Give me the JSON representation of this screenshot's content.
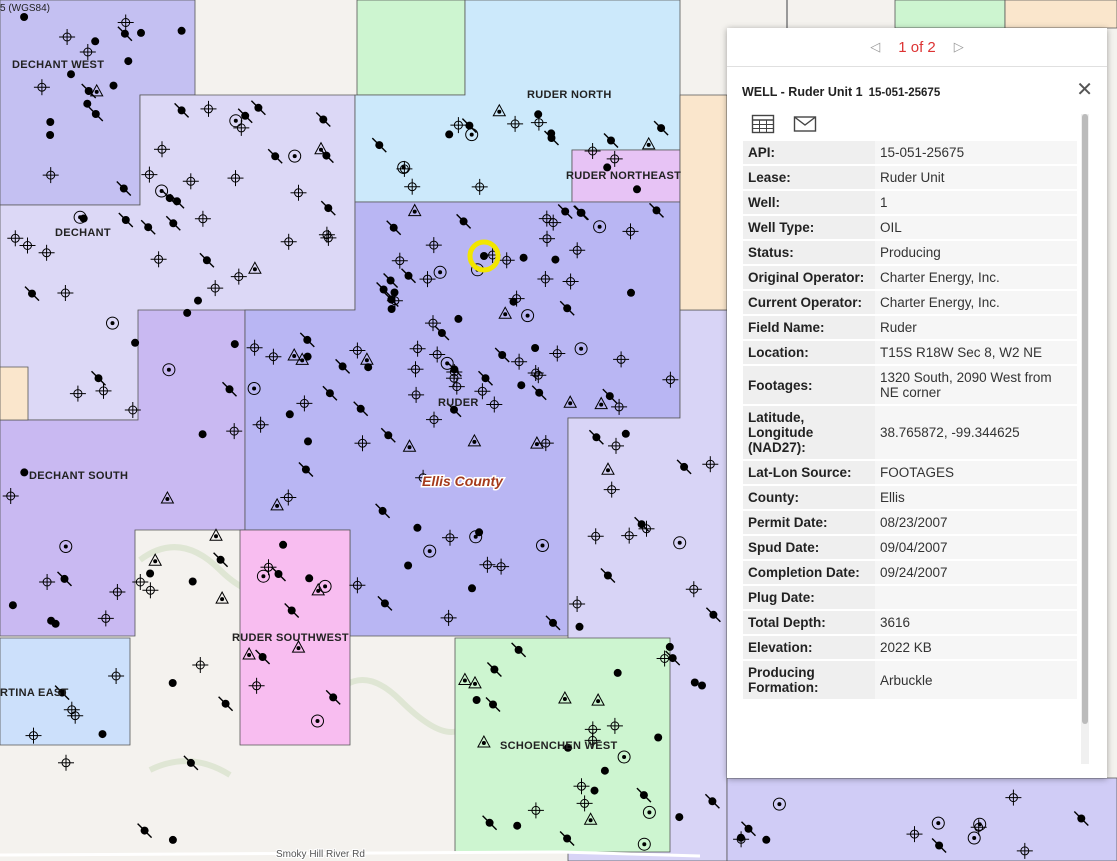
{
  "map": {
    "wgs_label": "5 (WGS84)",
    "county_label": "Ellis County",
    "road_label": "Smoky Hill River Rd",
    "fields": [
      {
        "name": "DECHANT WEST"
      },
      {
        "name": "RUDER NORTH"
      },
      {
        "name": "RUDER NORTHEAST"
      },
      {
        "name": "DECHANT"
      },
      {
        "name": "RUDER"
      },
      {
        "name": "DECHANT SOUTH"
      },
      {
        "name": "RUDER SOUTHWEST"
      },
      {
        "name": "RTINA EAST"
      },
      {
        "name": "SCHOENCHEN WEST"
      }
    ],
    "colors": {
      "purple": "#c4c0f2",
      "lavender": "#dcd8f6",
      "blue_violet": "#b9b6f3",
      "light_blue": "#cce9fb",
      "green": "#cdf5d0",
      "pink": "#f8bdf0",
      "magenta_light": "#e7c3f5",
      "peach": "#fae6cc",
      "highlight": "#f2e600"
    }
  },
  "popup": {
    "pager": {
      "prev_icon": "chevron-left-icon",
      "next_icon": "chevron-right-icon",
      "count": "1 of 2"
    },
    "title": "WELL - Ruder Unit 1",
    "subtitle": "15-051-25675",
    "tools": [
      "table-icon",
      "mail-icon"
    ],
    "rows": [
      {
        "key": "API:",
        "value": "15-051-25675"
      },
      {
        "key": "Lease:",
        "value": "Ruder Unit"
      },
      {
        "key": "Well:",
        "value": "1"
      },
      {
        "key": "Well Type:",
        "value": "OIL"
      },
      {
        "key": "Status:",
        "value": "Producing"
      },
      {
        "key": "Original Operator:",
        "value": "Charter Energy, Inc."
      },
      {
        "key": "Current Operator:",
        "value": "Charter Energy, Inc."
      },
      {
        "key": "Field Name:",
        "value": "Ruder"
      },
      {
        "key": "Location:",
        "value": "T15S R18W Sec 8, W2 NE"
      },
      {
        "key": "Footages:",
        "value": "1320 South, 2090 West from NE corner"
      },
      {
        "key": "Latitude, Longitude (NAD27):",
        "value": "38.765872,  -99.344625"
      },
      {
        "key": "Lat-Lon Source:",
        "value": "FOOTAGES"
      },
      {
        "key": "County:",
        "value": "Ellis"
      },
      {
        "key": "Permit Date:",
        "value": "08/23/2007"
      },
      {
        "key": "Spud Date:",
        "value": "09/04/2007"
      },
      {
        "key": "Completion Date:",
        "value": "09/24/2007"
      },
      {
        "key": "Plug Date:",
        "value": ""
      },
      {
        "key": "Total Depth:",
        "value": "3616"
      },
      {
        "key": "Elevation:",
        "value": "2022 KB"
      },
      {
        "key": "Producing Formation:",
        "value": "Arbuckle"
      }
    ]
  }
}
